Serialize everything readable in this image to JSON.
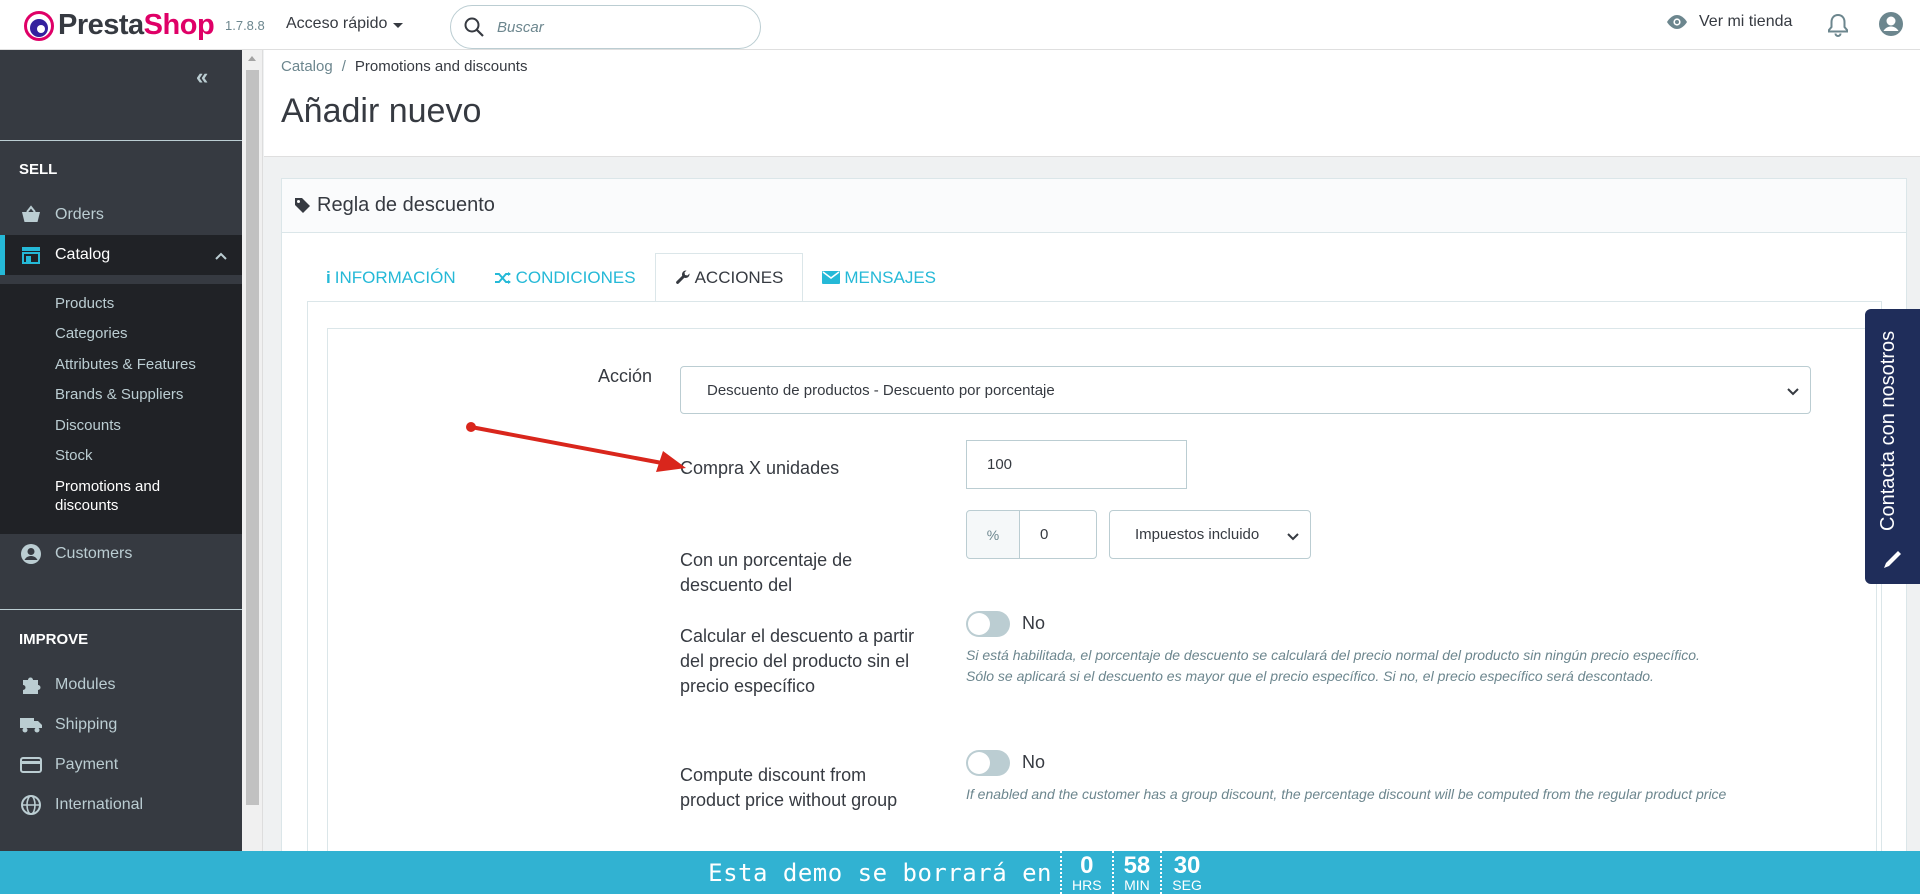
{
  "header": {
    "logo_text_1": "Presta",
    "logo_text_2": "Shop",
    "version": "1.7.8.8",
    "quick_access": "Acceso rápido",
    "search_placeholder": "Buscar",
    "view_shop": "Ver mi tienda"
  },
  "sidebar": {
    "sections": [
      "SELL",
      "IMPROVE"
    ],
    "items": [
      {
        "label": "Orders",
        "icon": "basket-icon"
      },
      {
        "label": "Catalog",
        "icon": "store-icon"
      },
      {
        "label": "Customers",
        "icon": "account-icon"
      },
      {
        "label": "Modules",
        "icon": "puzzle-icon"
      },
      {
        "label": "Shipping",
        "icon": "truck-icon"
      },
      {
        "label": "Payment",
        "icon": "card-icon"
      },
      {
        "label": "International",
        "icon": "globe-icon"
      }
    ],
    "catalog_sub": [
      "Products",
      "Categories",
      "Attributes & Features",
      "Brands & Suppliers",
      "Discounts",
      "Stock",
      "Promotions and discounts"
    ]
  },
  "breadcrumb": {
    "parent": "Catalog",
    "current": "Promotions and discounts"
  },
  "page_title": "Añadir nuevo",
  "panel": {
    "title": "Regla de descuento",
    "tabs": [
      "INFORMACIÓN",
      "CONDICIONES",
      "ACCIONES",
      "MENSAJES"
    ],
    "active_tab": "ACCIONES"
  },
  "form": {
    "accion_label": "Acción",
    "accion_value": "Descuento de productos - Descuento por porcentaje",
    "compra_label": "Compra X unidades",
    "compra_value": "100",
    "porcentaje_label_1": "Con un porcentaje de",
    "porcentaje_label_2": "descuento del",
    "percent_addon": "%",
    "porcentaje_value": "0",
    "impuestos_value": "Impuestos incluido",
    "calcular_label_1": "Calcular el descuento a partir",
    "calcular_label_2": "del precio del producto sin el",
    "calcular_label_3": "precio específico",
    "calcular_toggle": "No",
    "calcular_help_1": "Si está habilitada, el porcentaje de descuento se calculará del precio normal del producto sin ningún precio específico.",
    "calcular_help_2": "Sólo se aplicará si el descuento es mayor que el precio específico. Si no, el precio específico será descontado.",
    "compute_label_1": "Compute discount from",
    "compute_label_2": "product price without group",
    "compute_toggle": "No",
    "compute_help": "If enabled and the customer has a group discount, the percentage discount will be computed from the regular product price"
  },
  "contact_tab": "Contacta con nosotros",
  "footer": {
    "message": "Esta demo se borrará en",
    "hrs": "0",
    "hrs_label": "HRS",
    "min": "58",
    "min_label": "MIN",
    "seg": "30",
    "seg_label": "SEG"
  },
  "colors": {
    "accent": "#25b9d7",
    "sidebar": "#363a41",
    "footer": "#31b2d2",
    "brand_pink": "#df0067",
    "arrow": "#d9261c"
  }
}
